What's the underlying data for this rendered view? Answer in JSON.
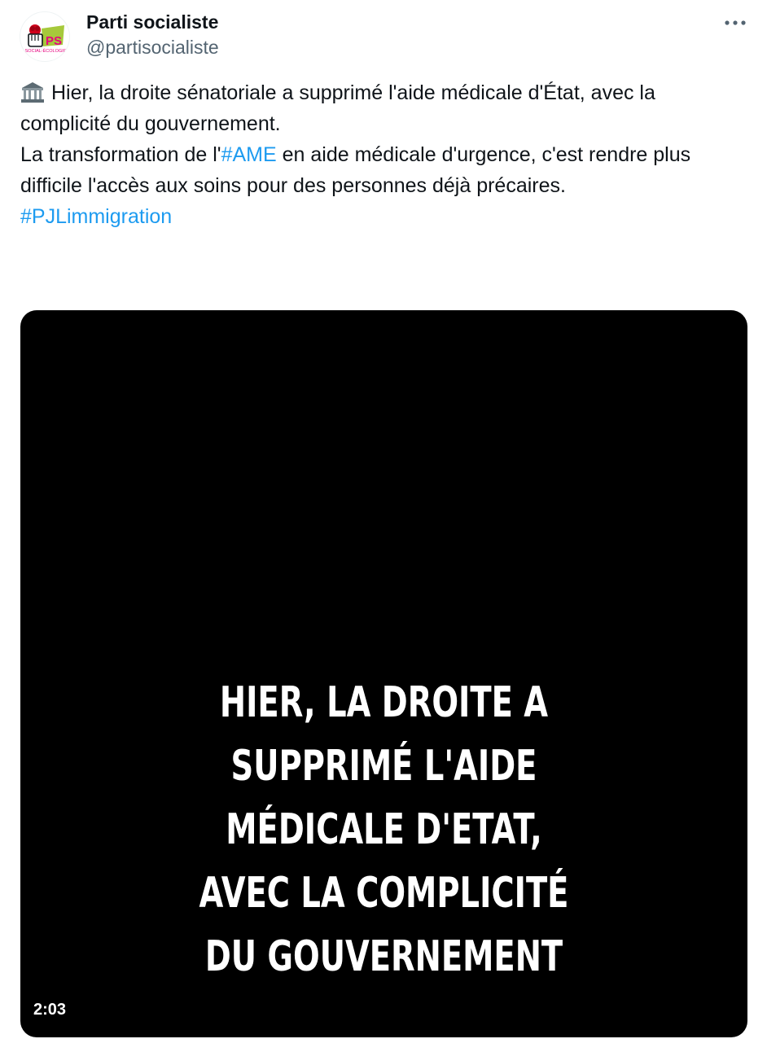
{
  "author": {
    "name": "Parti socialiste",
    "handle": "@partisocialiste",
    "avatar_logo": {
      "letters": "PS",
      "tagline": "SOCIAL-ÉCOLOGIE"
    }
  },
  "more_icon": "more-horizontal-icon",
  "tweet": {
    "emoji": "classical-building-icon",
    "paragraph1": "Hier, la droite sénatoriale a supprimé l'aide médicale d'État, avec la complicité du gouvernement.",
    "paragraph2_before": "La transformation de l'",
    "paragraph2_hashtag": "#AME",
    "paragraph2_after": " en aide médicale d'urgence, c'est rendre plus difficile l'accès aux soins pour des personnes déjà précaires.",
    "hashtag_line": "#PJLimmigration"
  },
  "video": {
    "caption_lines": [
      "HIER, LA DROITE A",
      "SUPPRIMÉ L'AIDE",
      "MÉDICALE D'ETAT,",
      "AVEC LA COMPLICITÉ",
      "DU GOUVERNEMENT"
    ],
    "duration": "2:03"
  },
  "colors": {
    "link": "#1d9bf0",
    "text": "#0f1419",
    "secondary": "#536471",
    "brand_pink": "#e6007e",
    "brand_green": "#a6c93b"
  }
}
